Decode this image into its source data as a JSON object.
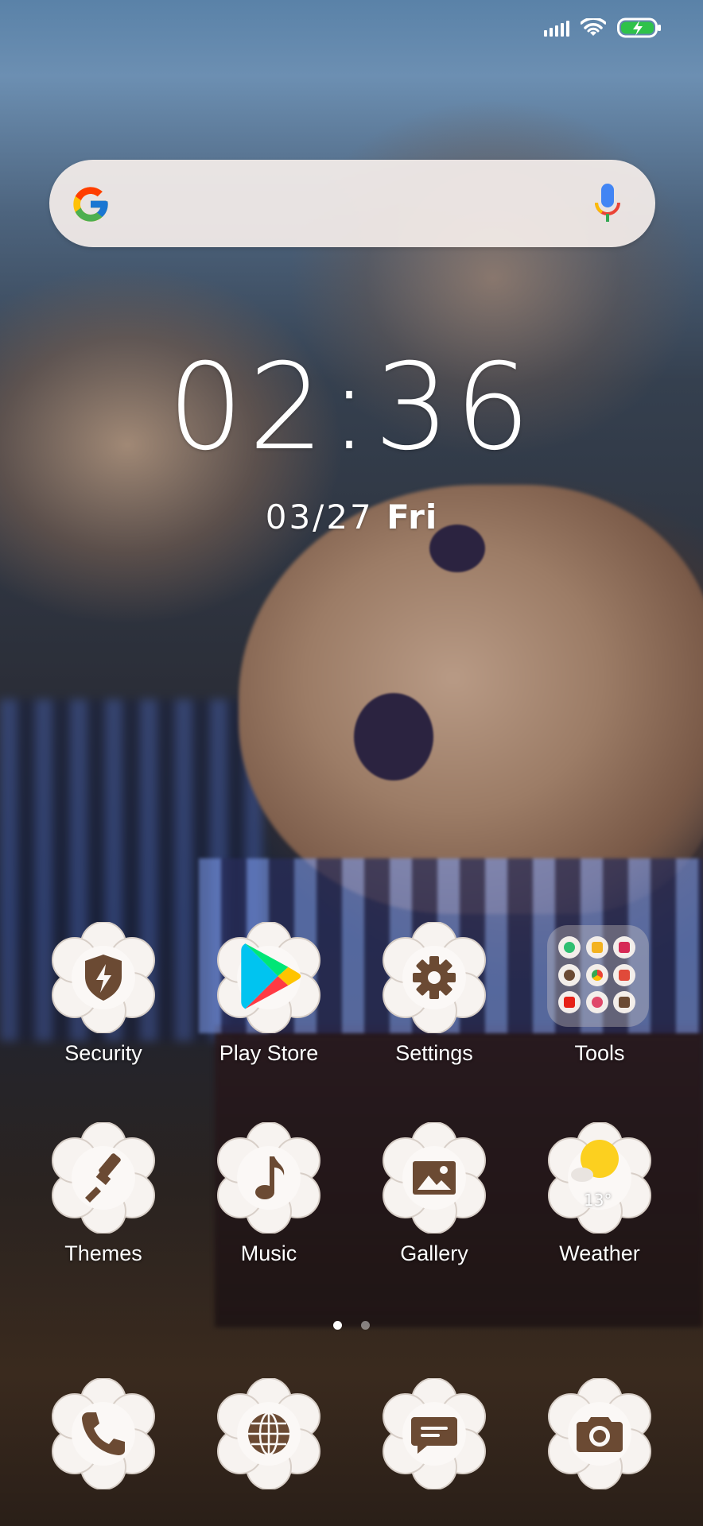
{
  "status_bar": {
    "signal_icon": "signal-bars-icon",
    "wifi_icon": "wifi-icon",
    "battery_icon": "battery-charging-icon",
    "battery_color": "#2ec24a"
  },
  "search": {
    "google_icon": "google-g-icon",
    "mic_icon": "microphone-icon"
  },
  "clock": {
    "time": "02:36",
    "date": "03/27",
    "day": "Fri"
  },
  "apps": [
    {
      "label": "Security",
      "icon": "shield-bolt-icon"
    },
    {
      "label": "Play Store",
      "icon": "play-store-icon"
    },
    {
      "label": "Settings",
      "icon": "gear-icon"
    },
    {
      "label": "Tools",
      "icon": "folder-icon"
    },
    {
      "label": "Themes",
      "icon": "paintbrush-icon"
    },
    {
      "label": "Music",
      "icon": "music-note-icon"
    },
    {
      "label": "Gallery",
      "icon": "image-icon"
    },
    {
      "label": "Weather",
      "icon": "sun-cloud-icon",
      "temperature": "13°"
    }
  ],
  "page_indicator": {
    "count": 2,
    "active": 0
  },
  "dock": [
    {
      "icon": "phone-icon"
    },
    {
      "icon": "globe-icon"
    },
    {
      "icon": "message-icon"
    },
    {
      "icon": "camera-icon"
    }
  ],
  "colors": {
    "icon_glyph": "#6b4a33",
    "flower": "#f7f3f0"
  }
}
